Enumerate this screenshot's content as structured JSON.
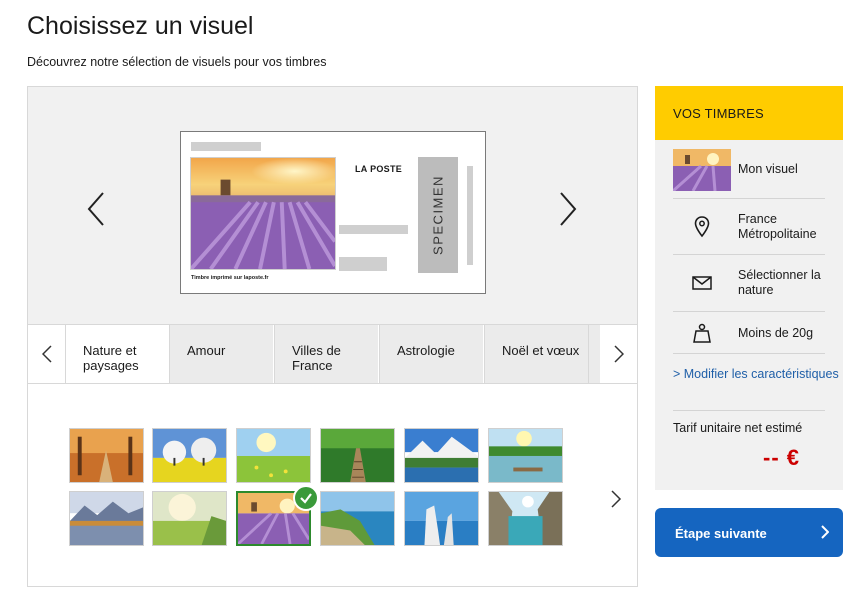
{
  "page": {
    "title": "Choisissez un visuel",
    "subtitle": "Découvrez notre sélection de visuels pour vos timbres"
  },
  "preview": {
    "prev_icon": "chevron-left-icon",
    "next_icon": "chevron-right-icon",
    "stamp": {
      "brand": "LA POSTE",
      "specimen": "SPECIMEN",
      "imprint": "Timbre imprimé sur laposte.fr"
    }
  },
  "tabs": {
    "items": [
      {
        "label": "Nature et paysages",
        "active": true
      },
      {
        "label": "Amour",
        "active": false
      },
      {
        "label": "Villes de France",
        "active": false
      },
      {
        "label": "Astrologie",
        "active": false
      },
      {
        "label": "Noël et vœux",
        "active": false
      }
    ]
  },
  "thumbnails": {
    "selected_index": 8,
    "count": 12
  },
  "sidebar": {
    "heading": "VOS TIMBRES",
    "visual_label": "Mon visuel",
    "destination": "France Métropolitaine",
    "nature": "Sélectionner la nature",
    "weight": "Moins de 20g",
    "modify_link": "> Modifier les caractéristiques",
    "tarif_label": "Tarif unitaire net estimé",
    "price": "-- €"
  },
  "actions": {
    "next_step": "Étape suivante"
  },
  "colors": {
    "accent_yellow": "#ffcc00",
    "button_blue": "#1565c0",
    "price_red": "#cc0000",
    "selected_green": "#3a9a3a"
  }
}
